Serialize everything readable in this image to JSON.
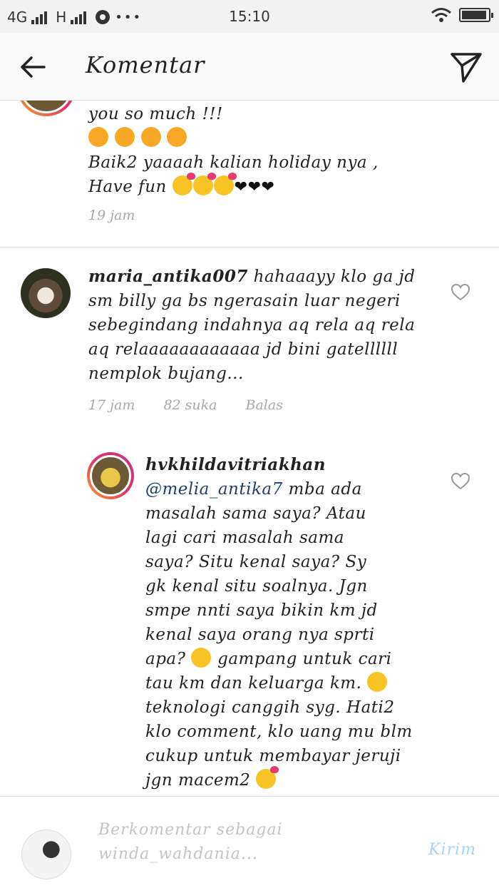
{
  "status_bar": {
    "network_1": "4G",
    "network_2": "H",
    "time": "15:10"
  },
  "header": {
    "title": "Komentar"
  },
  "comments": [
    {
      "lines": [
        "you so much !!!",
        "",
        "Baik2 yaaaah kalian holiday nya ,",
        "Have fun"
      ],
      "time": "19 jam"
    },
    {
      "username": "maria_antika007",
      "text_first": "hahaaayy klo ga jd",
      "lines": [
        "sm billy ga bs ngerasain luar negeri",
        "sebegindang indahnya  aq rela aq rela",
        "aq relaaaaaaaaaaaa jd bini gatellllll",
        "nemplok bujang..."
      ],
      "time": "17 jam",
      "likes": "82 suka",
      "reply": "Balas"
    },
    {
      "username": "hvkhildavitriakhan",
      "mention": "@melia_antika7",
      "text_first": "mba ada",
      "lines": [
        "masalah sama saya? Atau",
        "lagi cari masalah sama",
        "saya? Situ kenal saya? Sy",
        "gk kenal situ soalnya. Jgn",
        "smpe nnti saya bikin km jd",
        "kenal saya orang nya sprti",
        "apa?",
        "tau km dan keluarga km.",
        "teknologi canggih syg. Hati2",
        "klo comment, klo uang mu blm",
        "cukup untuk membayar jeruji",
        "jgn macem2"
      ],
      "inline_after_apa": "gampang untuk cari"
    }
  ],
  "composer": {
    "placeholder": "Berkomentar sebagai winda_wahdania...",
    "send_label": "Kirim"
  }
}
